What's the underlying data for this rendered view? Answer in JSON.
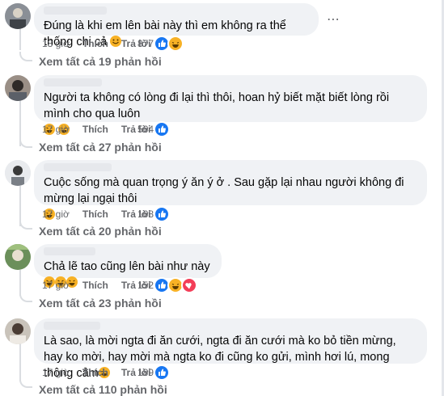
{
  "comments": [
    {
      "text": "Đúng là khi em lên bài này thì em không ra thể thống chi cả",
      "emojis": [
        "smile"
      ],
      "time": "18 giờ",
      "like_label": "Thích",
      "reply_label": "Trả lời",
      "reaction_count": "877",
      "reactions": [
        "like",
        "haha"
      ],
      "view_replies": "Xem tất cả 19 phản hồi"
    },
    {
      "text": "Người ta không có lòng đi lại thì thôi, hoan hỷ biết mặt biết lòng rồi mình cho qua luôn",
      "emojis": [
        "rofl",
        "rofl"
      ],
      "time": "17 giờ",
      "like_label": "Thích",
      "reply_label": "Trả lời",
      "reaction_count": "564",
      "reactions": [
        "like"
      ],
      "view_replies": "Xem tất cả 27 phản hồi"
    },
    {
      "text": "Cuộc sống mà quan trọng ý ăn ý ở . Sau gặp lại nhau người không đi mừng lại ngại thôi",
      "emojis": [
        "laugh"
      ],
      "time": "17 giờ",
      "like_label": "Thích",
      "reply_label": "Trả lời",
      "reaction_count": "168",
      "reactions": [
        "like"
      ],
      "view_replies": "Xem tất cả 20 phản hồi"
    },
    {
      "text": "Chả lẽ tao cũng lên bài như này",
      "emojis": [
        "rofl",
        "rofl",
        "rofl"
      ],
      "time": "17 giờ",
      "like_label": "Thích",
      "reply_label": "Trả lời",
      "reaction_count": "152",
      "reactions": [
        "like",
        "haha",
        "love"
      ],
      "view_replies": "Xem tất cả 23 phản hồi"
    },
    {
      "text": "Là sao, là mời ngta đi ăn cưới, ngta đi ăn cưới mà ko bỏ tiền mừng, hay ko mời, hay mời mà ngta ko đi cũng ko gửi, mình hơi lú, mong thông cảm",
      "emojis": [
        "laugh"
      ],
      "time": "17 giờ",
      "like_label": "Thích",
      "reply_label": "Trả lời",
      "reaction_count": "189",
      "reactions": [
        "like"
      ],
      "view_replies": "Xem tất cả 110 phản hồi"
    }
  ],
  "more_icon": "more-horizontal-icon",
  "colors": {
    "bubble": "#f0f2f5",
    "meta": "#65676b",
    "like": "#1877f2",
    "haha": "#f7b125",
    "love": "#f33e58"
  }
}
